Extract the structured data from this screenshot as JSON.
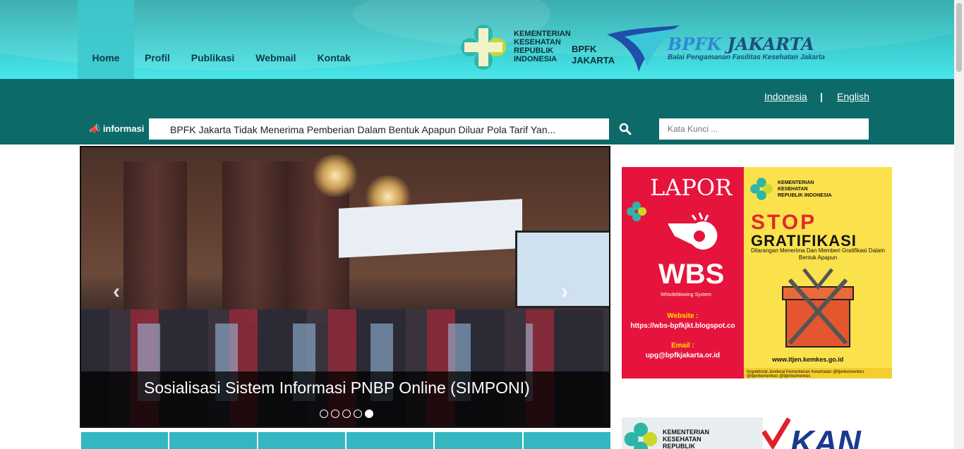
{
  "nav": {
    "items": [
      {
        "label": "Home"
      },
      {
        "label": "Profil"
      },
      {
        "label": "Publikasi"
      },
      {
        "label": "Webmail"
      },
      {
        "label": "Kontak"
      }
    ],
    "active_index": 0
  },
  "logos": {
    "kemkes_text": "KEMENTERIAN KESEHATAN REPUBLIK INDONESIA",
    "bpfk_small_line1": "BPFK",
    "bpfk_small_line2": "JAKARTA",
    "bpfk_big_b": "BPFK",
    "bpfk_big_j": "JAKARTA",
    "bpfk_big_sub": "Balai Pengamanan Fasilitas Kesehatan Jakarta"
  },
  "language": {
    "indonesia": "Indonesia",
    "separator": "|",
    "english": "English"
  },
  "ticker": {
    "label": "informasi",
    "label_icon": "megaphone-icon",
    "text": "BPFK Jakarta Tidak Menerima Pemberian Dalam Bentuk Apapun Diluar Pola Tarif Yan..."
  },
  "search": {
    "icon": "search-icon",
    "placeholder": "Kata Kunci ..."
  },
  "slider": {
    "caption": "Sosialisasi Sistem Informasi PNBP Online (SIMPONI)",
    "prev": "‹",
    "next": "›",
    "dot_count": 5,
    "active_dot": 4
  },
  "sidebar": {
    "lapor": {
      "title": "LAPOR",
      "wbs": "WBS",
      "wbs_sub": "Whistleblowing System",
      "website_label": "Website :",
      "website_value": "https://wbs-bpfkjkt.blogspot.co",
      "email_label": "Email :",
      "email_value": "upg@bpfkjakarta.or.id"
    },
    "stop": {
      "kemkes": "KEMENTERIAN KESEHATAN REPUBLIK INDONESIA",
      "title": "STOP",
      "subtitle": "GRATIFIKASI",
      "desc": "Dilarangan Menerima Dan Memberi Gratifikasi Dalam Bentuk Apapun",
      "url": "www.itjen.kemkes.go.id",
      "footer": "Inspektorat Jenderal Kementerian Kesehatan  @itjenkemenkes  @itjenkemenkes  @itjenkemenkes"
    },
    "ad2_text": "KEMENTERIAN KESEHATAN REPUBLIK",
    "kan_text": "KAN"
  },
  "colors": {
    "topbar": "#37c5c7",
    "teal_bar": "#0c6a68",
    "tile": "#34b7c0",
    "lapor_red": "#e6143c",
    "stop_yellow": "#fbe24c"
  }
}
